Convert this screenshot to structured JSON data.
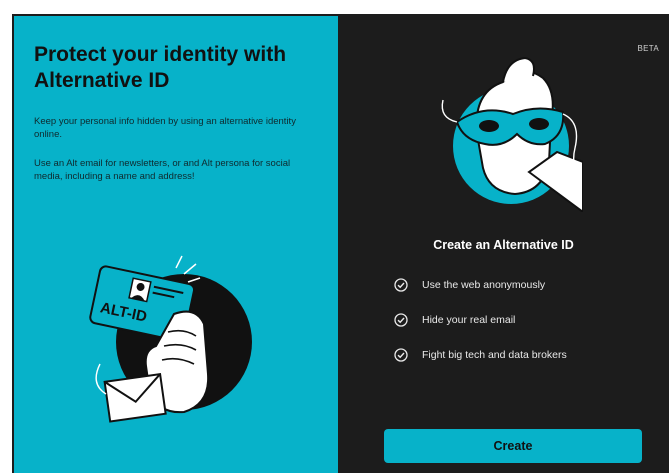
{
  "left": {
    "headline": "Protect your identity with Alternative ID",
    "paragraph_1": "Keep your personal info hidden by using an alternative identity online.",
    "paragraph_2": "Use an Alt email for newsletters, or and Alt persona for social media, including a name and address!",
    "card_text": "ALT-ID",
    "illustration": "alt-id-card-hand-illustration"
  },
  "right": {
    "badge": "BETA",
    "illustration": "masquerade-mask-illustration",
    "title": "Create an Alternative ID",
    "features": [
      "Use the web anonymously",
      "Hide your real email",
      "Fight big tech and data brokers"
    ],
    "feature_icon": "check-circle-icon",
    "button_label": "Create"
  },
  "colors": {
    "accent": "#07b2c9",
    "dark_panel": "#1c1c1c",
    "text_on_dark": "#ffffff"
  }
}
